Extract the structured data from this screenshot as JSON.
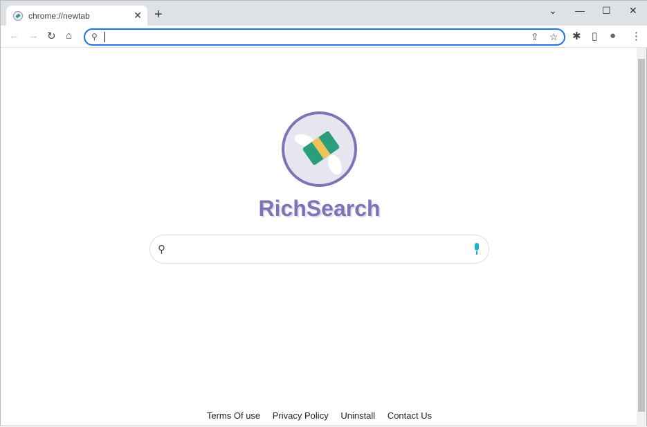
{
  "tab": {
    "title": "chrome://newtab",
    "close": "✕"
  },
  "new_tab": "+",
  "window": {
    "dropdown": "⌄",
    "minimize": "—",
    "maximize": "☐",
    "close": "✕"
  },
  "toolbar": {
    "back": "←",
    "forward": "→",
    "reload": "↻",
    "home": "⌂",
    "omnibox_value": "",
    "share": "⇪",
    "bookmark": "☆",
    "extensions": "✱",
    "sidepanel": "▯",
    "profile": "●",
    "menu": "⋮"
  },
  "brand": {
    "name": "RichSearch"
  },
  "search": {
    "value": "",
    "placeholder": ""
  },
  "footer": {
    "links": [
      "Terms Of use",
      "Privacy Policy",
      "Uninstall",
      "Contact Us"
    ]
  },
  "colors": {
    "brand": "#7b74b5",
    "accent": "#1a73e8",
    "mic": "#19b3c4"
  }
}
